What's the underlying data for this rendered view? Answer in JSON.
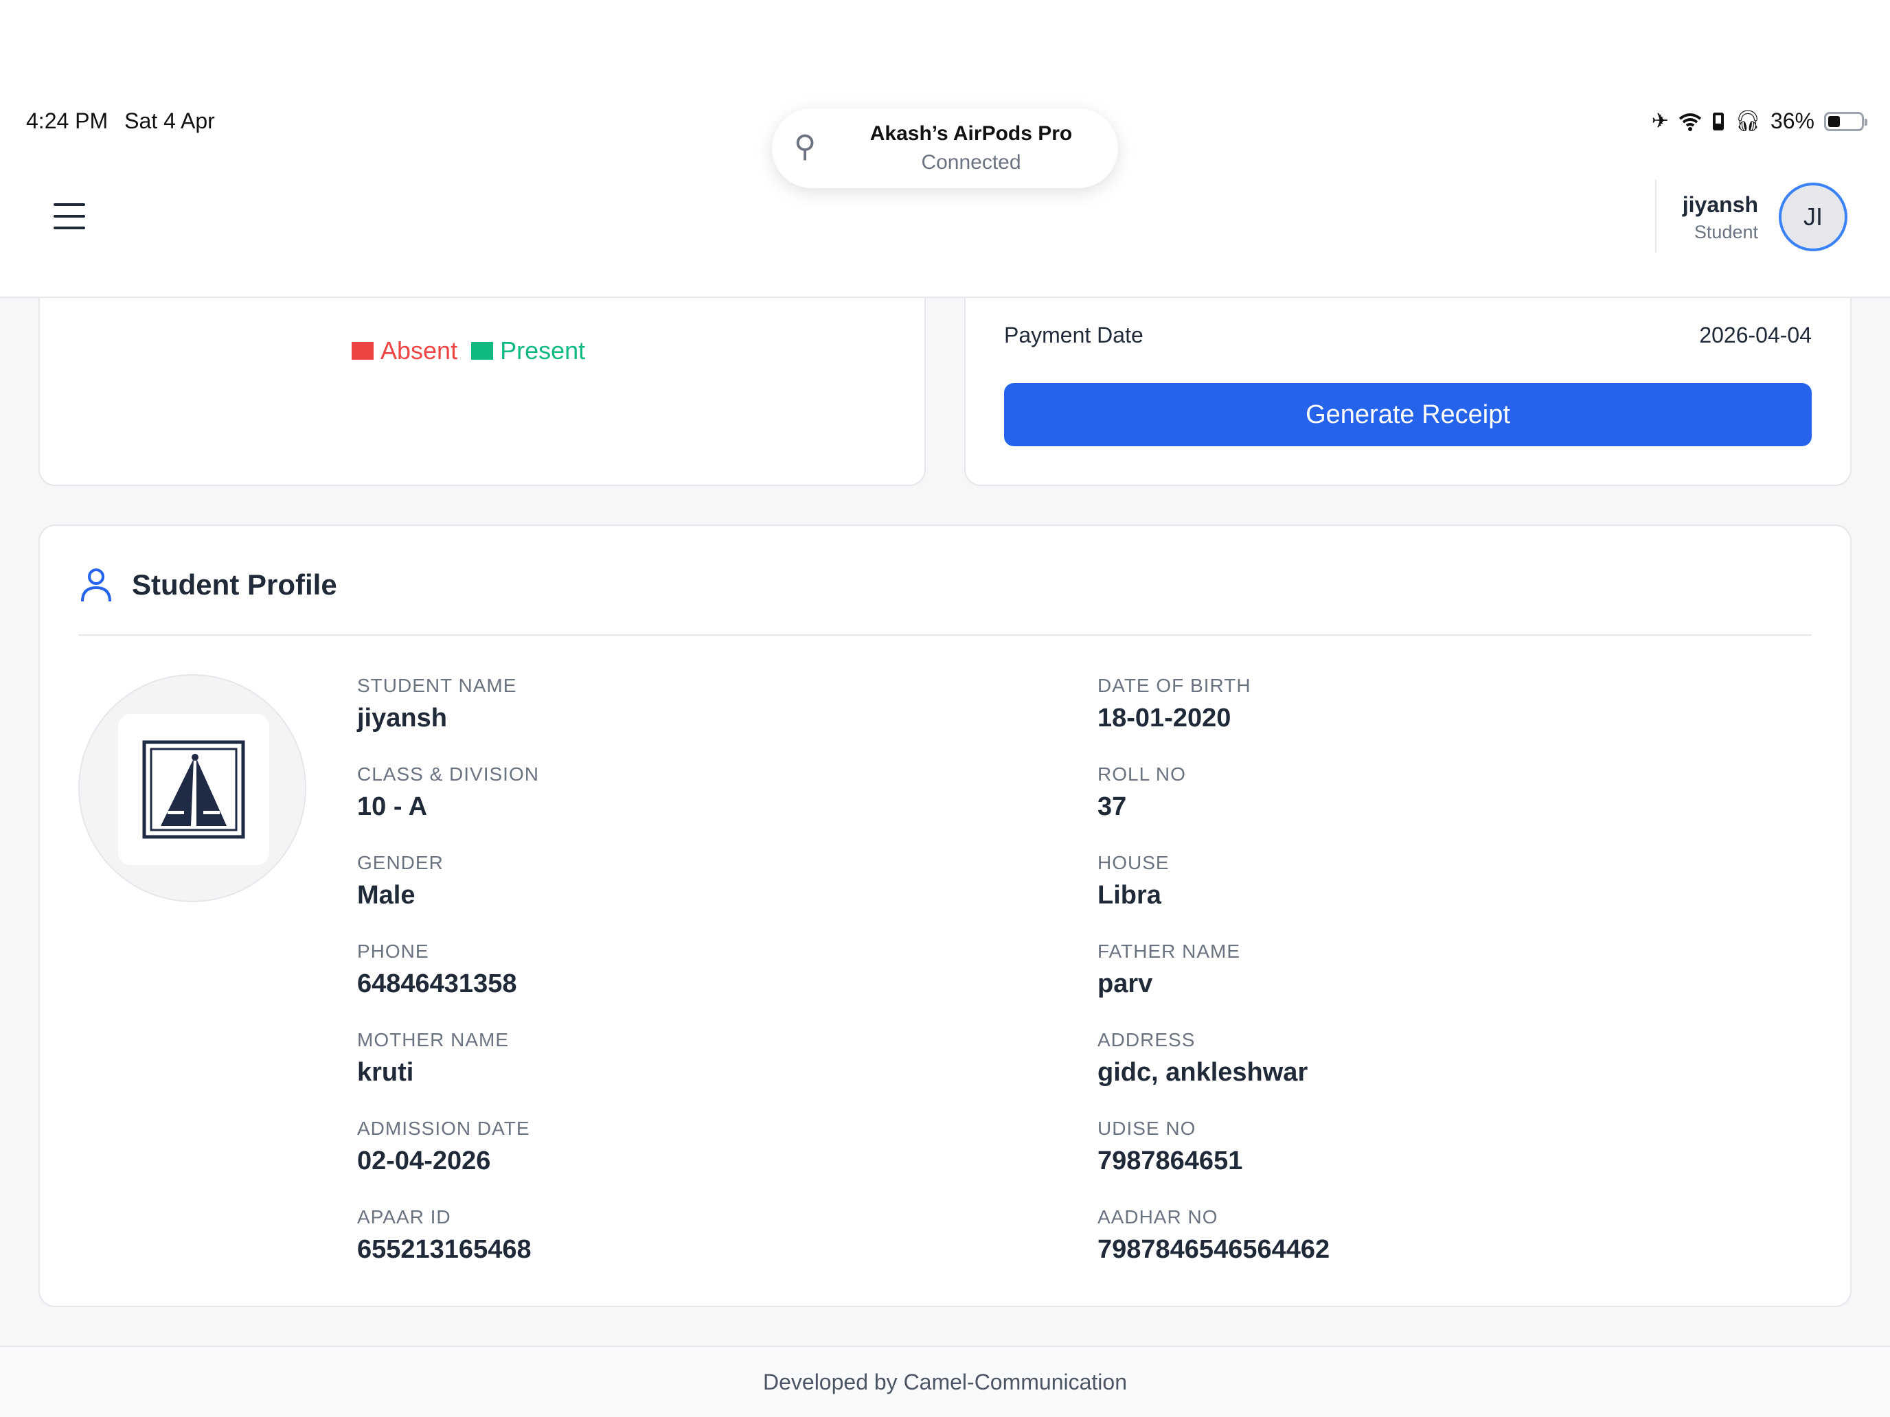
{
  "status_bar": {
    "time": "4:24 PM",
    "date": "Sat 4 Apr",
    "battery": "36%",
    "battery_level": 0.36,
    "icons": [
      "airplane-icon",
      "wifi-icon",
      "phone-icon",
      "headphones-icon",
      "battery-icon"
    ]
  },
  "notification": {
    "title": "Akash’s AirPods Pro",
    "subtitle": "Connected",
    "icon": "airpods-icon"
  },
  "header": {
    "menu_icon": "hamburger-menu-icon",
    "user_name": "jiyansh",
    "user_role": "Student",
    "avatar_initials": "JI"
  },
  "attendance": {
    "legend": [
      {
        "label": "Absent",
        "color": "#ef4444"
      },
      {
        "label": "Present",
        "color": "#10b981"
      }
    ]
  },
  "fees": {
    "payment_date_label": "Payment Date",
    "payment_date_value": "2026-04-04",
    "generate_button": "Generate Receipt"
  },
  "profile": {
    "title": "Student Profile",
    "fields_left": [
      {
        "label": "STUDENT NAME",
        "value": "jiyansh"
      },
      {
        "label": "CLASS & DIVISION",
        "value": "10 - A"
      },
      {
        "label": "GENDER",
        "value": "Male"
      },
      {
        "label": "PHONE",
        "value": "64846431358"
      },
      {
        "label": "MOTHER NAME",
        "value": "kruti"
      },
      {
        "label": "ADMISSION DATE",
        "value": "02-04-2026"
      },
      {
        "label": "APAAR ID",
        "value": "655213165468"
      }
    ],
    "fields_right": [
      {
        "label": "DATE OF BIRTH",
        "value": "18-01-2020"
      },
      {
        "label": "ROLL NO",
        "value": "37"
      },
      {
        "label": "HOUSE",
        "value": "Libra"
      },
      {
        "label": "FATHER NAME",
        "value": "parv"
      },
      {
        "label": "ADDRESS",
        "value": "gidc, ankleshwar"
      },
      {
        "label": "UDISE NO",
        "value": "7987864651"
      },
      {
        "label": "AADHAR NO",
        "value": "7987846546564462"
      }
    ]
  },
  "footer": {
    "text": "Developed by Camel-Communication"
  },
  "colors": {
    "accent": "#2563eb",
    "absent": "#ef4444",
    "present": "#10b981"
  }
}
